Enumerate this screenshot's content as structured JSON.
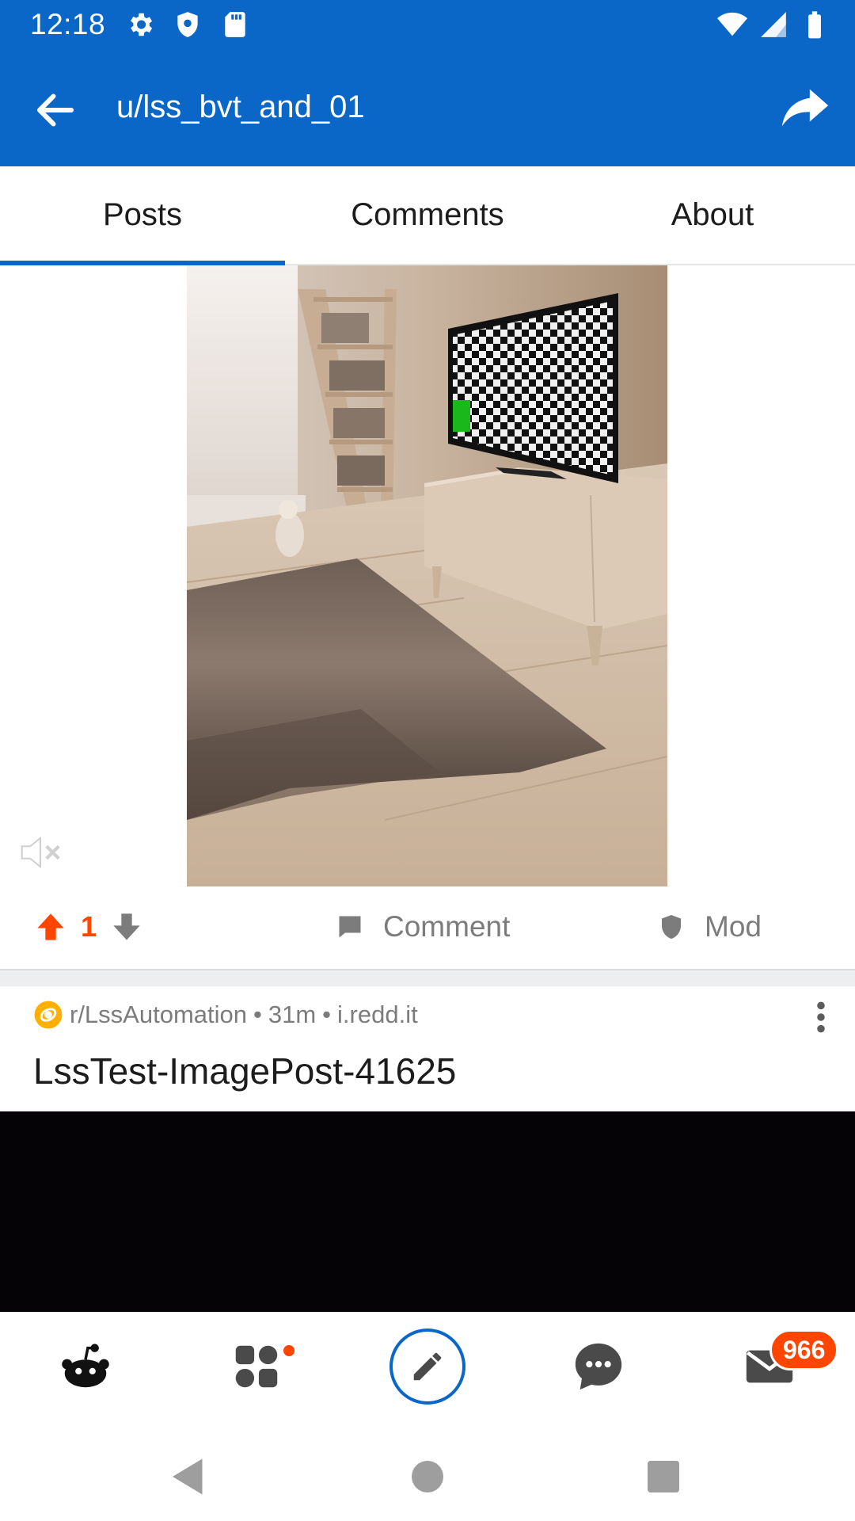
{
  "status_bar": {
    "time": "12:18",
    "icons_left": [
      "gear-icon",
      "shield-icon",
      "sd-card-icon"
    ],
    "icons_right": [
      "wifi-icon",
      "signal-icon",
      "battery-icon"
    ]
  },
  "app_bar": {
    "title": "u/lss_bvt_and_01",
    "back_icon": "back-arrow-icon",
    "share_icon": "share-icon",
    "background": "#0a67c8"
  },
  "tabs": [
    {
      "label": "Posts",
      "active": true
    },
    {
      "label": "Comments",
      "active": false
    },
    {
      "label": "About",
      "active": false
    }
  ],
  "post1": {
    "vote_count": "1",
    "comment_label": "Comment",
    "mod_label": "Mod"
  },
  "post2": {
    "subreddit": "r/LssAutomation",
    "time": "31m",
    "domain": "i.redd.it",
    "separator": "•",
    "title": "LssTest-ImagePost-41625"
  },
  "bottom_nav": {
    "items": [
      "home-icon",
      "communities-icon",
      "create-icon",
      "chat-icon",
      "inbox-icon"
    ],
    "inbox_badge": "966"
  },
  "colors": {
    "accent": "#0a67c8",
    "upvote": "#ff4500",
    "muted": "#7c7c7c"
  }
}
